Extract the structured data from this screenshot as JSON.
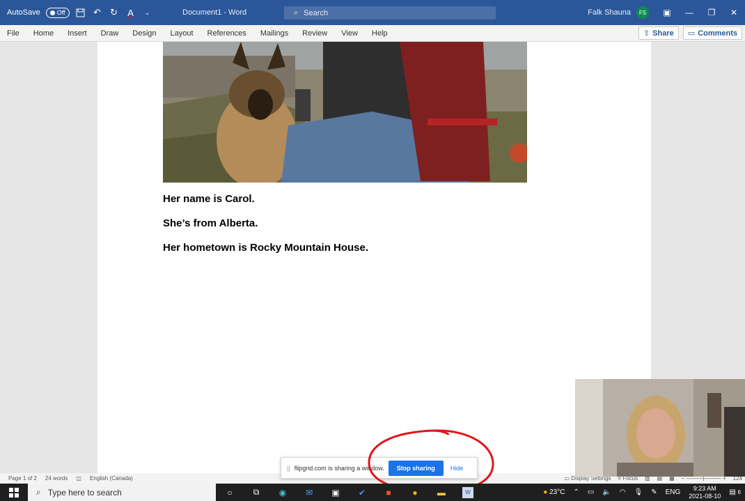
{
  "titlebar": {
    "autosave_label": "AutoSave",
    "autosave_state": "Off",
    "doc_title": "Document1  -  Word",
    "search_placeholder": "Search",
    "username": "Falk Shauna",
    "user_initials": "FS"
  },
  "ribbon": {
    "tabs": [
      {
        "label": "File"
      },
      {
        "label": "Home"
      },
      {
        "label": "Insert"
      },
      {
        "label": "Draw"
      },
      {
        "label": "Design"
      },
      {
        "label": "Layout"
      },
      {
        "label": "References"
      },
      {
        "label": "Mailings"
      },
      {
        "label": "Review"
      },
      {
        "label": "View"
      },
      {
        "label": "Help"
      }
    ],
    "share_label": "Share",
    "comments_label": "Comments"
  },
  "document": {
    "lines": [
      "Her name is Carol.",
      "She’s from Alberta.",
      "Her hometown is Rocky Mountain House."
    ]
  },
  "statusbar": {
    "page": "Page 1 of 2",
    "words": "24 words",
    "language": "English (Canada)",
    "display_settings": "Display Settings",
    "focus": "Focus",
    "zoom": "124"
  },
  "share_banner": {
    "message": "flipgrid.com is sharing a window.",
    "stop_label": "Stop sharing",
    "hide_label": "Hide"
  },
  "taskbar": {
    "search_placeholder": "Type here to search",
    "weather": "23°C",
    "language": "ENG",
    "time": "9:23 AM",
    "date": "2021-08-10",
    "notification_count": "6"
  },
  "colors": {
    "word_blue": "#2b579a",
    "stop_button": "#1a73e8",
    "annotation_red": "#e0151b"
  }
}
